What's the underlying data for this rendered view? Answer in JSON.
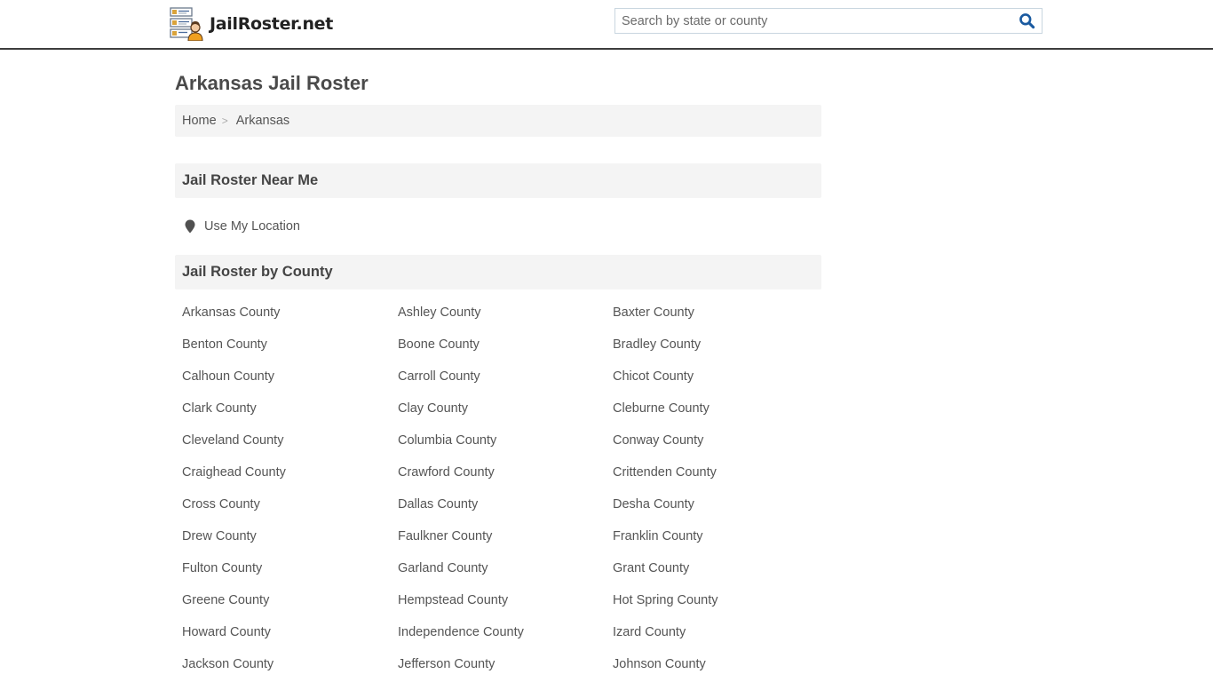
{
  "header": {
    "logo_text": "JailRoster.net",
    "search": {
      "placeholder": "Search by state or county",
      "value": "",
      "icon": "search-icon",
      "icon_color": "#1a5aa0"
    }
  },
  "page": {
    "title": "Arkansas Jail Roster",
    "breadcrumb": [
      {
        "label": "Home"
      },
      {
        "label": "Arkansas"
      }
    ],
    "breadcrumb_separator": ">"
  },
  "near_me": {
    "heading": "Jail Roster Near Me",
    "use_location_label": "Use My Location",
    "icon": "map-marker-icon"
  },
  "by_county": {
    "heading": "Jail Roster by County",
    "counties": [
      "Arkansas County",
      "Ashley County",
      "Baxter County",
      "Benton County",
      "Boone County",
      "Bradley County",
      "Calhoun County",
      "Carroll County",
      "Chicot County",
      "Clark County",
      "Clay County",
      "Cleburne County",
      "Cleveland County",
      "Columbia County",
      "Conway County",
      "Craighead County",
      "Crawford County",
      "Crittenden County",
      "Cross County",
      "Dallas County",
      "Desha County",
      "Drew County",
      "Faulkner County",
      "Franklin County",
      "Fulton County",
      "Garland County",
      "Grant County",
      "Greene County",
      "Hempstead County",
      "Hot Spring County",
      "Howard County",
      "Independence County",
      "Izard County",
      "Jackson County",
      "Jefferson County",
      "Johnson County"
    ]
  },
  "colors": {
    "header_border": "#3d3d3d",
    "section_bg": "#f4f4f4",
    "text": "#555555",
    "search_accent": "#1a5aa0"
  }
}
